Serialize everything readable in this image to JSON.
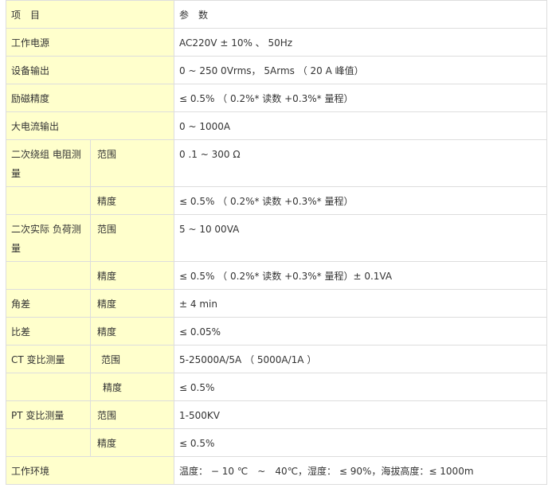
{
  "table": {
    "header": {
      "item": "项　目",
      "param": "参　数"
    },
    "rows": {
      "power": {
        "label": "工作电源",
        "value": "AC220V ± 10% 、 50Hz"
      },
      "output": {
        "label": "设备输出",
        "value": "0 ~ 250 0Vrms， 5Arms （ 20 A 峰值）"
      },
      "excitation": {
        "label": "励磁精度",
        "value": "≤ 0.5% （ 0.2%* 读数 +0.3%* 量程）"
      },
      "current_out": {
        "label": "大电流输出",
        "value": "0 ~ 1000A"
      },
      "winding": {
        "label": "二次绕组 电阻测量",
        "range_label": "范围",
        "range_value": "0 .1 ~ 300 Ω",
        "acc_label": "精度",
        "acc_value": "≤ 0.5% （ 0.2%* 读数 +0.3%* 量程）"
      },
      "burden": {
        "label": "二次实际 负荷测量",
        "range_label": "范围",
        "range_value": "5 ~ 10 00VA",
        "acc_label": "精度",
        "acc_value": "≤ 0.5% （ 0.2%* 读数 +0.3%* 量程）± 0.1VA"
      },
      "angle": {
        "label": "角差",
        "sub_label": "精度",
        "value": "± 4 min"
      },
      "ratio": {
        "label": "比差",
        "sub_label": "精度",
        "value": "≤ 0.05%"
      },
      "ct": {
        "label": "CT 变比测量",
        "range_label": "范围",
        "range_value": "5-25000A/5A （ 5000A/1A ）",
        "acc_label": "精度",
        "acc_value": "≤ 0.5%"
      },
      "pt": {
        "label": "PT 变比测量",
        "range_label": "范围",
        "range_value": "1-500KV",
        "acc_label": "精度",
        "acc_value": "≤ 0.5%"
      },
      "environment": {
        "label": "工作环境",
        "value": "温度： − 10 ℃　~　40℃，湿度： ≤ 90%，海拔高度：≤ 1000m"
      }
    }
  }
}
